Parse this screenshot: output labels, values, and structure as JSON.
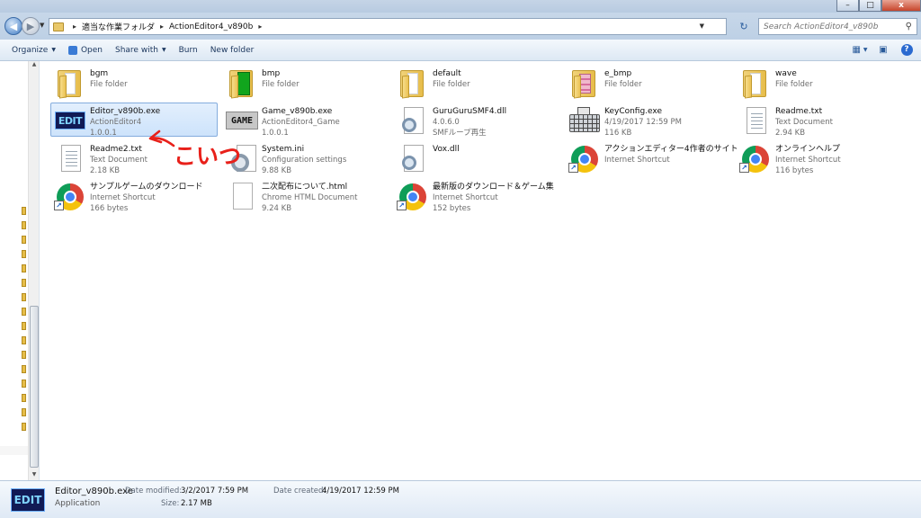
{
  "window": {
    "minimize_glyph": "–",
    "maximize_glyph": "□",
    "close_glyph": "x"
  },
  "address": {
    "breadcrumbs": [
      "適当な作業フォルダ",
      "ActionEditor4_v890b"
    ],
    "search_placeholder": "Search ActionEditor4_v890b"
  },
  "toolbar": {
    "organize": "Organize",
    "open": "Open",
    "share_with": "Share with",
    "burn": "Burn",
    "new_folder": "New folder"
  },
  "files": [
    {
      "name": "bgm",
      "line2": "File folder",
      "line3": "",
      "icon": "folder-icon"
    },
    {
      "name": "bmp",
      "line2": "File folder",
      "line3": "",
      "icon": "folder-green-icon"
    },
    {
      "name": "default",
      "line2": "File folder",
      "line3": "",
      "icon": "folder-icon"
    },
    {
      "name": "e_bmp",
      "line2": "File folder",
      "line3": "",
      "icon": "folder-pink-icon"
    },
    {
      "name": "wave",
      "line2": "File folder",
      "line3": "",
      "icon": "folder-icon"
    },
    {
      "name": "Editor_v890b.exe",
      "line2": "ActionEditor4",
      "line3": "1.0.0.1",
      "icon": "edit-app-icon"
    },
    {
      "name": "Game_v890b.exe",
      "line2": "ActionEditor4_Game",
      "line3": "1.0.0.1",
      "icon": "game-app-icon"
    },
    {
      "name": "GuruGuruSMF4.dll",
      "line2": "4.0.6.0",
      "line3": "SMFループ再生",
      "icon": "dll-icon"
    },
    {
      "name": "KeyConfig.exe",
      "line2": "4/19/2017 12:59 PM",
      "line3": "116 KB",
      "icon": "keyboard-icon"
    },
    {
      "name": "Readme.txt",
      "line2": "Text Document",
      "line3": "2.94 KB",
      "icon": "text-document-icon"
    },
    {
      "name": "Readme2.txt",
      "line2": "Text Document",
      "line3": "2.18 KB",
      "icon": "text-document-icon"
    },
    {
      "name": "System.ini",
      "line2": "Configuration settings",
      "line3": "9.88 KB",
      "icon": "settings-gear-icon"
    },
    {
      "name": "Vox.dll",
      "line2": "",
      "line3": "",
      "icon": "dll-icon"
    },
    {
      "name": "アクションエディター4作者のサイト",
      "line2": "Internet Shortcut",
      "line3": "",
      "icon": "chrome-shortcut-icon"
    },
    {
      "name": "オンラインヘルプ",
      "line2": "Internet Shortcut",
      "line3": "116 bytes",
      "icon": "chrome-shortcut-icon"
    },
    {
      "name": "サンプルゲームのダウンロード",
      "line2": "Internet Shortcut",
      "line3": "166 bytes",
      "icon": "chrome-shortcut-icon"
    },
    {
      "name": "二次配布について.html",
      "line2": "Chrome HTML Document",
      "line3": "9.24 KB",
      "icon": "html-document-icon"
    },
    {
      "name": "最新版のダウンロード＆ゲーム集",
      "line2": "Internet Shortcut",
      "line3": "152 bytes",
      "icon": "chrome-shortcut-icon"
    }
  ],
  "annotation": {
    "text": "こいつ",
    "color": "#e8201a"
  },
  "details": {
    "name": "Editor_v890b.exe",
    "type": "Application",
    "date_modified_label": "Date modified:",
    "date_modified": "3/2/2017 7:59 PM",
    "size_label": "Size:",
    "size": "2.17 MB",
    "date_created_label": "Date created:",
    "date_created": "4/19/2017 12:59 PM"
  },
  "edit_logo_text": "EDIT",
  "game_logo_text": "GAME"
}
